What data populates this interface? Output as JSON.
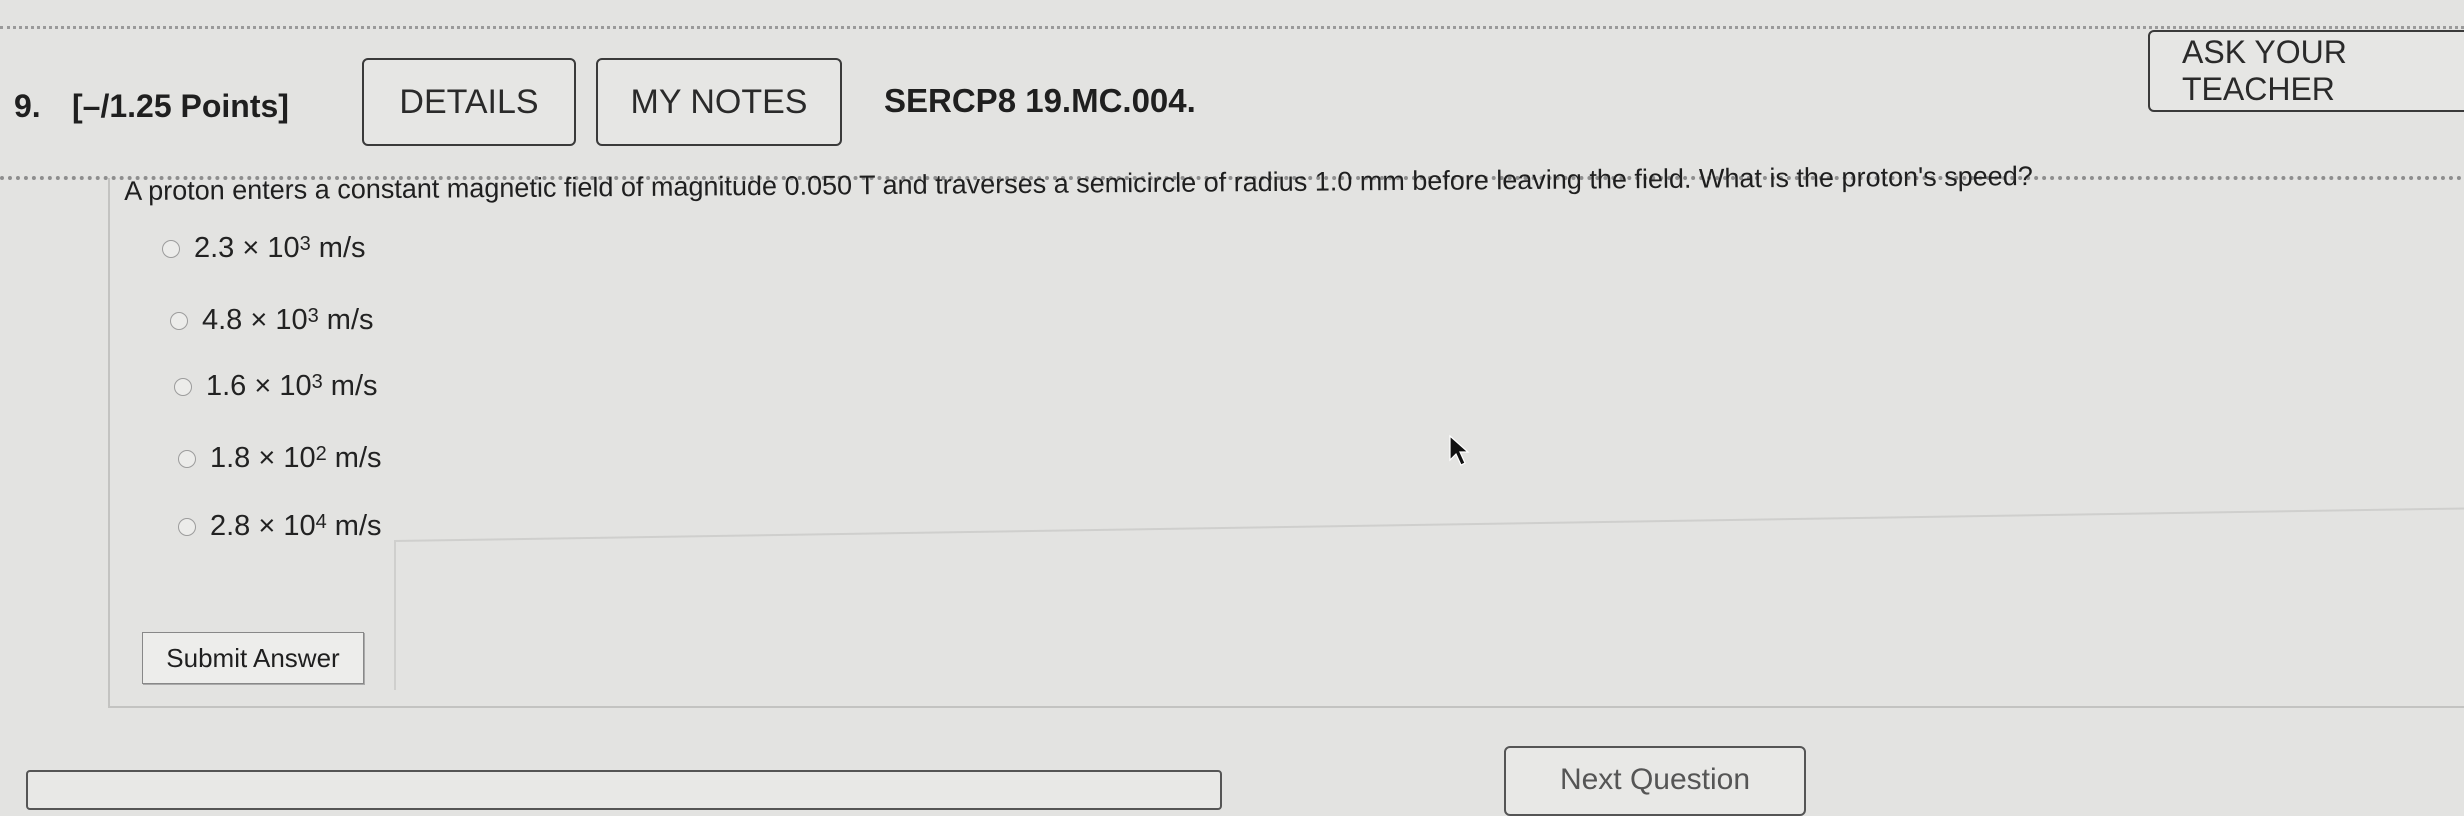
{
  "question": {
    "number": "9.",
    "points": "[–/1.25 Points]",
    "details_label": "DETAILS",
    "notes_label": "MY NOTES",
    "code": "SERCP8 19.MC.004.",
    "ask_teacher_label": "ASK YOUR TEACHER",
    "prompt": "A proton enters a constant magnetic field of magnitude 0.050 T and traverses a semicircle of radius 1.0 mm before leaving the field. What is the proton's speed?",
    "options": [
      {
        "mantissa": "2.3 × 10",
        "exponent": "3",
        "unit": " m/s"
      },
      {
        "mantissa": "4.8 × 10",
        "exponent": "3",
        "unit": " m/s"
      },
      {
        "mantissa": "1.6 × 10",
        "exponent": "3",
        "unit": " m/s"
      },
      {
        "mantissa": "1.8 × 10",
        "exponent": "2",
        "unit": " m/s"
      },
      {
        "mantissa": "2.8 × 10",
        "exponent": "4",
        "unit": " m/s"
      }
    ],
    "submit_label": "Submit Answer"
  },
  "footer": {
    "next_question_label": "Next Question"
  }
}
